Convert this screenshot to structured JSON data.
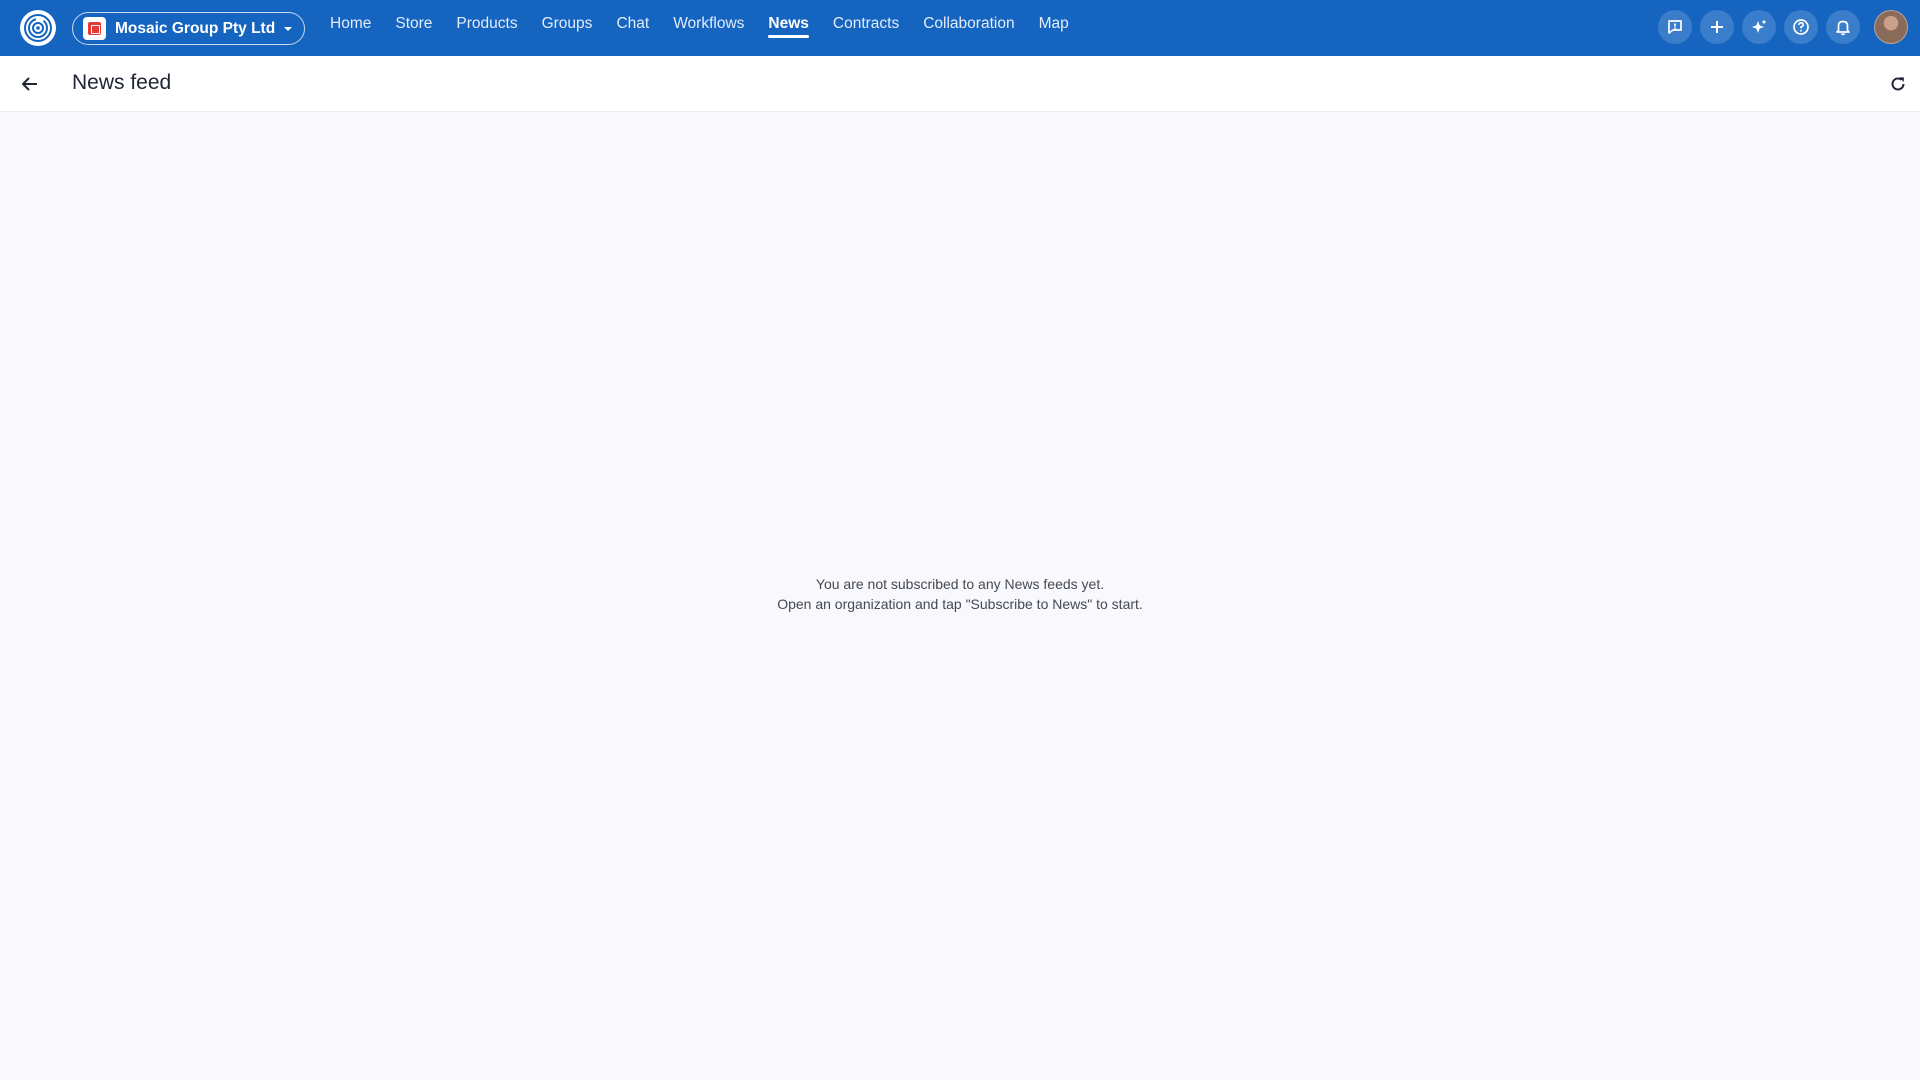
{
  "org": {
    "name": "Mosaic Group Pty Ltd"
  },
  "nav": {
    "items": [
      {
        "label": "Home"
      },
      {
        "label": "Store"
      },
      {
        "label": "Products"
      },
      {
        "label": "Groups"
      },
      {
        "label": "Chat"
      },
      {
        "label": "Workflows"
      },
      {
        "label": "News"
      },
      {
        "label": "Contracts"
      },
      {
        "label": "Collaboration"
      },
      {
        "label": "Map"
      }
    ],
    "active": "News"
  },
  "actions": {
    "icons": [
      "feedback-icon",
      "plus-icon",
      "sparkle-icon",
      "help-icon",
      "bell-icon"
    ]
  },
  "page": {
    "title": "News feed"
  },
  "empty_state": {
    "line1": "You are not subscribed to any News feeds yet.",
    "line2": "Open an organization and tap \"Subscribe to News\" to start."
  },
  "colors": {
    "topbar": "#1565c0",
    "background": "#f8f8fd",
    "org_logo": "#e53935"
  }
}
